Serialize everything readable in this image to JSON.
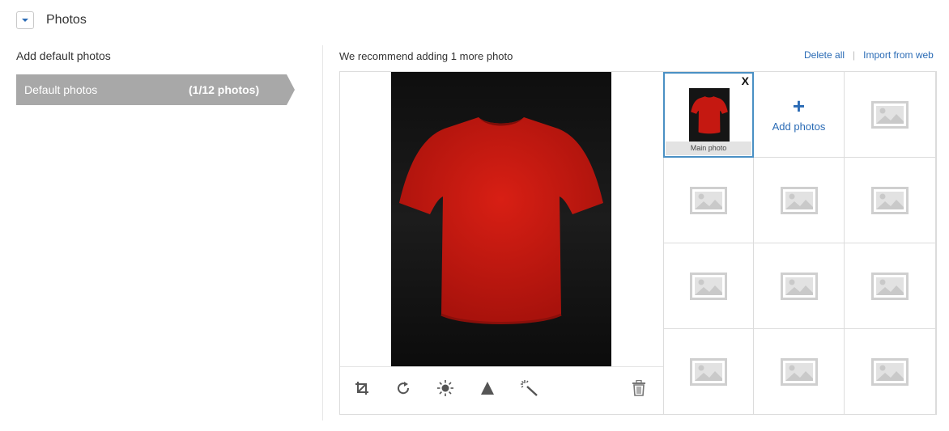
{
  "header": {
    "title": "Photos",
    "toggle_icon": "chevron-down-icon"
  },
  "sidebar": {
    "title": "Add default photos",
    "item": {
      "label": "Default photos",
      "count": "(1/12 photos)",
      "color": "#a8a8a8"
    }
  },
  "editor": {
    "recommendation": "We recommend adding 1 more photo",
    "delete_all": "Delete all",
    "separator": "|",
    "import_from_web": "Import from web",
    "main_image": "red-tshirt-photo",
    "tools": [
      "crop-icon",
      "rotate-icon",
      "brightness-icon",
      "contrast-icon",
      "magic-wand-icon",
      "trash-icon"
    ]
  },
  "gallery": {
    "main_caption": "Main photo",
    "remove_label": "X",
    "add_label": "Add photos",
    "add_icon": "+",
    "accent": "#2a6bb5",
    "selected_border": "#4a90c4",
    "placeholder_icon": "image-placeholder-icon"
  }
}
